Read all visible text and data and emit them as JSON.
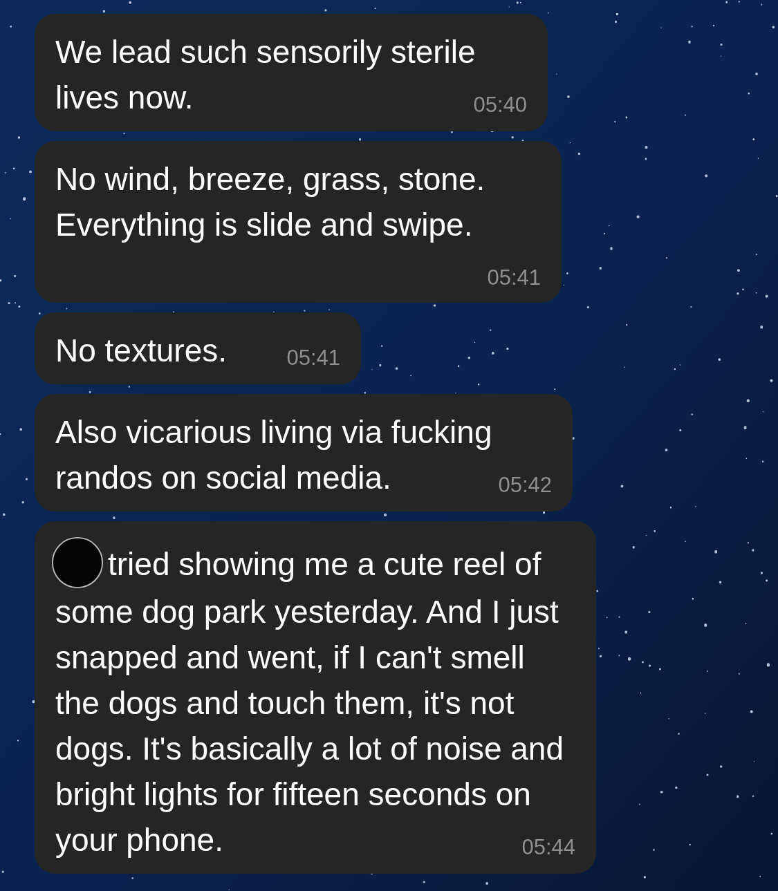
{
  "messages": [
    {
      "text": "We lead such sensorily sterile lives now.",
      "time": "05:40"
    },
    {
      "text": "No wind, breeze, grass, stone. Everything is slide and swipe.",
      "time": "05:41"
    },
    {
      "text": "No textures.",
      "time": "05:41"
    },
    {
      "text": "Also vicarious living via fucking randos on social media.",
      "time": "05:42"
    },
    {
      "text": "tried showing me a cute reel of some dog park yesterday. And I just snapped and went, if I can't smell the dogs and touch them, it's not dogs.  It's basically a lot of noise and bright lights for fifteen seconds on your phone.",
      "time": "05:44",
      "redacted_mention": true
    }
  ]
}
